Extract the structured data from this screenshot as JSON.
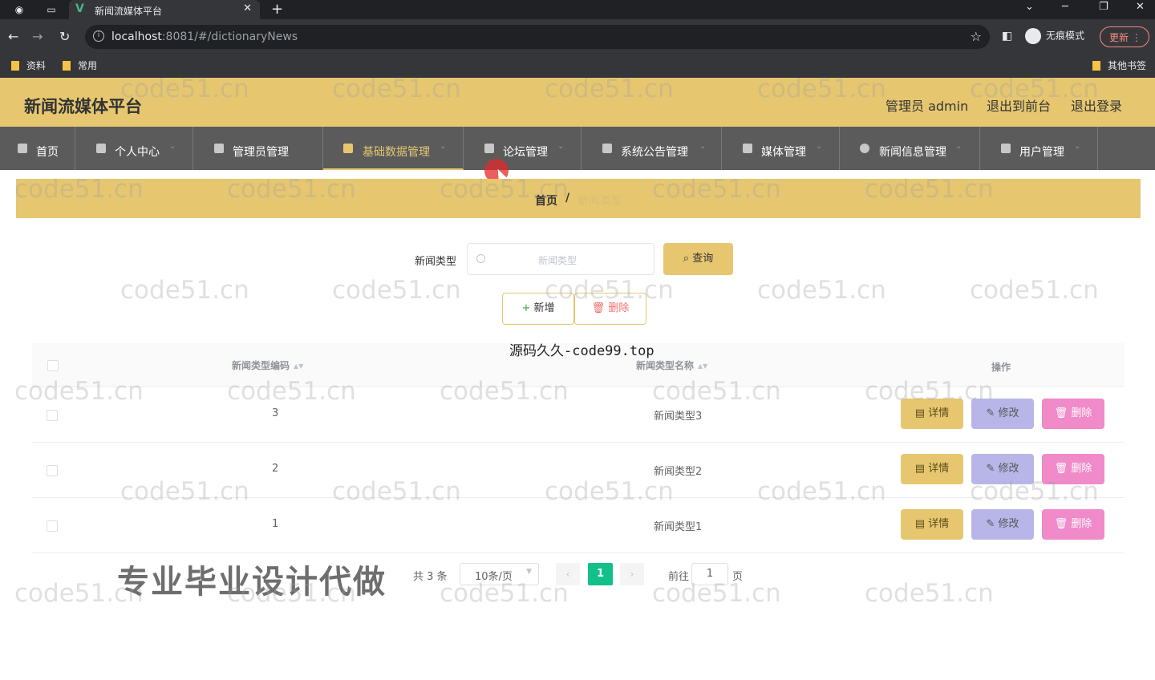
{
  "browser": {
    "tab_title": "新闻流媒体平台",
    "url_host": "localhost",
    "url_rest": ":8081/#/dictionaryNews",
    "incognito_label": "无痕模式",
    "update_label": "更新",
    "bookmarks": [
      "资料",
      "常用"
    ],
    "other_bookmarks": "其他书签"
  },
  "header": {
    "title": "新闻流媒体平台",
    "admin": "管理员 admin",
    "to_front": "退出到前台",
    "logout": "退出登录"
  },
  "nav": {
    "items": [
      {
        "label": "首页",
        "icon": "home-icon"
      },
      {
        "label": "个人中心",
        "icon": "user-icon"
      },
      {
        "label": "管理员管理",
        "icon": "briefcase-icon"
      },
      {
        "label": "基础数据管理",
        "icon": "chat-icon"
      },
      {
        "label": "论坛管理",
        "icon": "flag-icon"
      },
      {
        "label": "系统公告管理",
        "icon": "list-icon"
      },
      {
        "label": "媒体管理",
        "icon": "document-icon"
      },
      {
        "label": "新闻信息管理",
        "icon": "clock-icon"
      },
      {
        "label": "用户管理",
        "icon": "chart-icon"
      }
    ],
    "active": "基础数据管理"
  },
  "breadcrumb": {
    "home": "首页",
    "separator": "/",
    "current": "新闻类型"
  },
  "search": {
    "label": "新闻类型",
    "placeholder": "新闻类型",
    "query_button": "查询"
  },
  "actions": {
    "add": "新增",
    "delete": "删除"
  },
  "table": {
    "headers": [
      "新闻类型编码",
      "新闻类型名称",
      "操作"
    ],
    "rows": [
      {
        "code": "3",
        "name": "新闻类型3"
      },
      {
        "code": "2",
        "name": "新闻类型2"
      },
      {
        "code": "1",
        "name": "新闻类型1"
      }
    ],
    "row_buttons": {
      "detail": "详情",
      "edit": "修改",
      "remove": "删除"
    }
  },
  "pagination": {
    "total": "共 3 条",
    "page_size": "10条/页",
    "current_page": "1",
    "goto_label": "前往",
    "goto_value": "1",
    "page_unit": "页"
  },
  "overlays": {
    "source_text": "源码久久-code99.top",
    "promo_text": "专业毕业设计代做",
    "watermark": "code51.cn"
  },
  "colors": {
    "accent": "#e6c770",
    "nav_bg": "#5b5b5b",
    "edit_button": "#b8b6e8",
    "remove_button": "#f08ac8",
    "page_active": "#13c08a"
  }
}
